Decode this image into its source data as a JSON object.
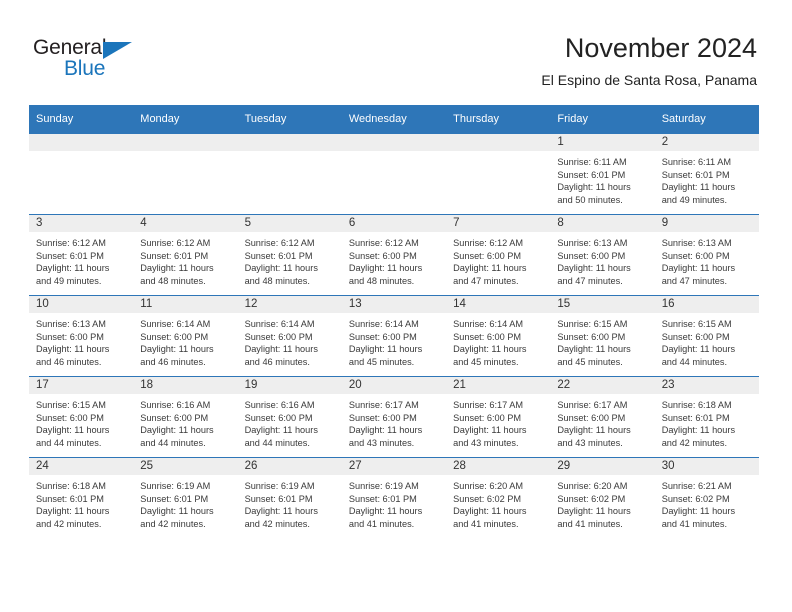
{
  "brand": {
    "name_dark": "General",
    "name_blue": "Blue",
    "accent_color": "#1b75bb"
  },
  "header": {
    "title": "November 2024",
    "subtitle": "El Espino de Santa Rosa, Panama",
    "header_bg": "#2e76b8",
    "daynum_bg": "#eeeeee"
  },
  "weekday_headers": [
    "Sunday",
    "Monday",
    "Tuesday",
    "Wednesday",
    "Thursday",
    "Friday",
    "Saturday"
  ],
  "weeks": [
    [
      {
        "day": "",
        "lines": []
      },
      {
        "day": "",
        "lines": []
      },
      {
        "day": "",
        "lines": []
      },
      {
        "day": "",
        "lines": []
      },
      {
        "day": "",
        "lines": []
      },
      {
        "day": "1",
        "lines": [
          "Sunrise: 6:11 AM",
          "Sunset: 6:01 PM",
          "Daylight: 11 hours",
          "and 50 minutes."
        ]
      },
      {
        "day": "2",
        "lines": [
          "Sunrise: 6:11 AM",
          "Sunset: 6:01 PM",
          "Daylight: 11 hours",
          "and 49 minutes."
        ]
      }
    ],
    [
      {
        "day": "3",
        "lines": [
          "Sunrise: 6:12 AM",
          "Sunset: 6:01 PM",
          "Daylight: 11 hours",
          "and 49 minutes."
        ]
      },
      {
        "day": "4",
        "lines": [
          "Sunrise: 6:12 AM",
          "Sunset: 6:01 PM",
          "Daylight: 11 hours",
          "and 48 minutes."
        ]
      },
      {
        "day": "5",
        "lines": [
          "Sunrise: 6:12 AM",
          "Sunset: 6:01 PM",
          "Daylight: 11 hours",
          "and 48 minutes."
        ]
      },
      {
        "day": "6",
        "lines": [
          "Sunrise: 6:12 AM",
          "Sunset: 6:00 PM",
          "Daylight: 11 hours",
          "and 48 minutes."
        ]
      },
      {
        "day": "7",
        "lines": [
          "Sunrise: 6:12 AM",
          "Sunset: 6:00 PM",
          "Daylight: 11 hours",
          "and 47 minutes."
        ]
      },
      {
        "day": "8",
        "lines": [
          "Sunrise: 6:13 AM",
          "Sunset: 6:00 PM",
          "Daylight: 11 hours",
          "and 47 minutes."
        ]
      },
      {
        "day": "9",
        "lines": [
          "Sunrise: 6:13 AM",
          "Sunset: 6:00 PM",
          "Daylight: 11 hours",
          "and 47 minutes."
        ]
      }
    ],
    [
      {
        "day": "10",
        "lines": [
          "Sunrise: 6:13 AM",
          "Sunset: 6:00 PM",
          "Daylight: 11 hours",
          "and 46 minutes."
        ]
      },
      {
        "day": "11",
        "lines": [
          "Sunrise: 6:14 AM",
          "Sunset: 6:00 PM",
          "Daylight: 11 hours",
          "and 46 minutes."
        ]
      },
      {
        "day": "12",
        "lines": [
          "Sunrise: 6:14 AM",
          "Sunset: 6:00 PM",
          "Daylight: 11 hours",
          "and 46 minutes."
        ]
      },
      {
        "day": "13",
        "lines": [
          "Sunrise: 6:14 AM",
          "Sunset: 6:00 PM",
          "Daylight: 11 hours",
          "and 45 minutes."
        ]
      },
      {
        "day": "14",
        "lines": [
          "Sunrise: 6:14 AM",
          "Sunset: 6:00 PM",
          "Daylight: 11 hours",
          "and 45 minutes."
        ]
      },
      {
        "day": "15",
        "lines": [
          "Sunrise: 6:15 AM",
          "Sunset: 6:00 PM",
          "Daylight: 11 hours",
          "and 45 minutes."
        ]
      },
      {
        "day": "16",
        "lines": [
          "Sunrise: 6:15 AM",
          "Sunset: 6:00 PM",
          "Daylight: 11 hours",
          "and 44 minutes."
        ]
      }
    ],
    [
      {
        "day": "17",
        "lines": [
          "Sunrise: 6:15 AM",
          "Sunset: 6:00 PM",
          "Daylight: 11 hours",
          "and 44 minutes."
        ]
      },
      {
        "day": "18",
        "lines": [
          "Sunrise: 6:16 AM",
          "Sunset: 6:00 PM",
          "Daylight: 11 hours",
          "and 44 minutes."
        ]
      },
      {
        "day": "19",
        "lines": [
          "Sunrise: 6:16 AM",
          "Sunset: 6:00 PM",
          "Daylight: 11 hours",
          "and 44 minutes."
        ]
      },
      {
        "day": "20",
        "lines": [
          "Sunrise: 6:17 AM",
          "Sunset: 6:00 PM",
          "Daylight: 11 hours",
          "and 43 minutes."
        ]
      },
      {
        "day": "21",
        "lines": [
          "Sunrise: 6:17 AM",
          "Sunset: 6:00 PM",
          "Daylight: 11 hours",
          "and 43 minutes."
        ]
      },
      {
        "day": "22",
        "lines": [
          "Sunrise: 6:17 AM",
          "Sunset: 6:00 PM",
          "Daylight: 11 hours",
          "and 43 minutes."
        ]
      },
      {
        "day": "23",
        "lines": [
          "Sunrise: 6:18 AM",
          "Sunset: 6:01 PM",
          "Daylight: 11 hours",
          "and 42 minutes."
        ]
      }
    ],
    [
      {
        "day": "24",
        "lines": [
          "Sunrise: 6:18 AM",
          "Sunset: 6:01 PM",
          "Daylight: 11 hours",
          "and 42 minutes."
        ]
      },
      {
        "day": "25",
        "lines": [
          "Sunrise: 6:19 AM",
          "Sunset: 6:01 PM",
          "Daylight: 11 hours",
          "and 42 minutes."
        ]
      },
      {
        "day": "26",
        "lines": [
          "Sunrise: 6:19 AM",
          "Sunset: 6:01 PM",
          "Daylight: 11 hours",
          "and 42 minutes."
        ]
      },
      {
        "day": "27",
        "lines": [
          "Sunrise: 6:19 AM",
          "Sunset: 6:01 PM",
          "Daylight: 11 hours",
          "and 41 minutes."
        ]
      },
      {
        "day": "28",
        "lines": [
          "Sunrise: 6:20 AM",
          "Sunset: 6:02 PM",
          "Daylight: 11 hours",
          "and 41 minutes."
        ]
      },
      {
        "day": "29",
        "lines": [
          "Sunrise: 6:20 AM",
          "Sunset: 6:02 PM",
          "Daylight: 11 hours",
          "and 41 minutes."
        ]
      },
      {
        "day": "30",
        "lines": [
          "Sunrise: 6:21 AM",
          "Sunset: 6:02 PM",
          "Daylight: 11 hours",
          "and 41 minutes."
        ]
      }
    ]
  ]
}
